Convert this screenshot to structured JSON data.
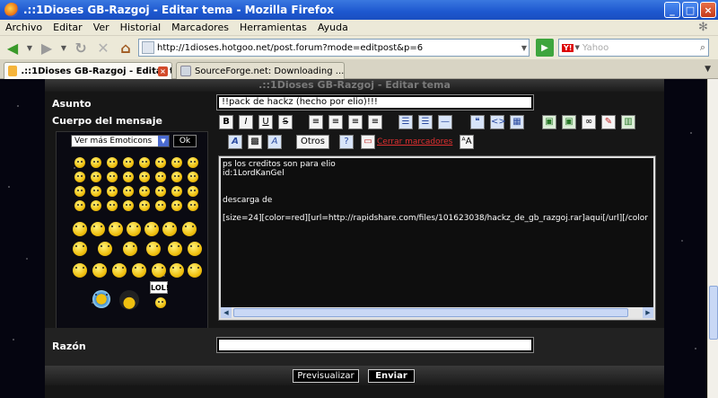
{
  "window": {
    "title": ".::1Dioses GB-Razgoj - Editar tema - Mozilla Firefox",
    "controls": {
      "minimize": "_",
      "maximize": "□",
      "close": "×"
    }
  },
  "menu": {
    "items": [
      "Archivo",
      "Editar",
      "Ver",
      "Historial",
      "Marcadores",
      "Herramientas",
      "Ayuda"
    ]
  },
  "nav": {
    "url": "http://1dioses.hotgoo.net/post.forum?mode=editpost&p=6",
    "search_placeholder": "Yahoo",
    "search_engine": "Y!",
    "go": "▶"
  },
  "tabs": [
    {
      "label": ".::1Dioses GB-Razgoj - Editar tema",
      "active": true
    },
    {
      "label": "SourceForge.net: Downloading ...",
      "active": false
    }
  ],
  "page": {
    "header_title": ".::1Dioses GB-Razgoj - Editar tema",
    "subject_label": "Asunto",
    "subject_value": "!!pack de hackz (hecho por elio)!!!",
    "body_label": "Cuerpo del mensaje",
    "emoticons_select": "Ver más Emoticons",
    "emoticons_ok": "Ok",
    "lol_text": "LOL!",
    "toolbar": {
      "bold": "B",
      "italic": "I",
      "underline": "U",
      "strike": "S",
      "otros": "Otros",
      "cerrar": "Cerrar marcadores"
    },
    "editor_content": "ps los creditos son para elio\nid:1LordKanGel\n\n\ndescarga de\n\n[size=24][color=red][url=http://rapidshare.com/files/101623038/hackz_de_gb_razgoj.rar]aqui[/url][/color",
    "reason_label": "Razón",
    "reason_value": "",
    "preview_button": "Previsualizar",
    "send_button": "Enviar"
  }
}
